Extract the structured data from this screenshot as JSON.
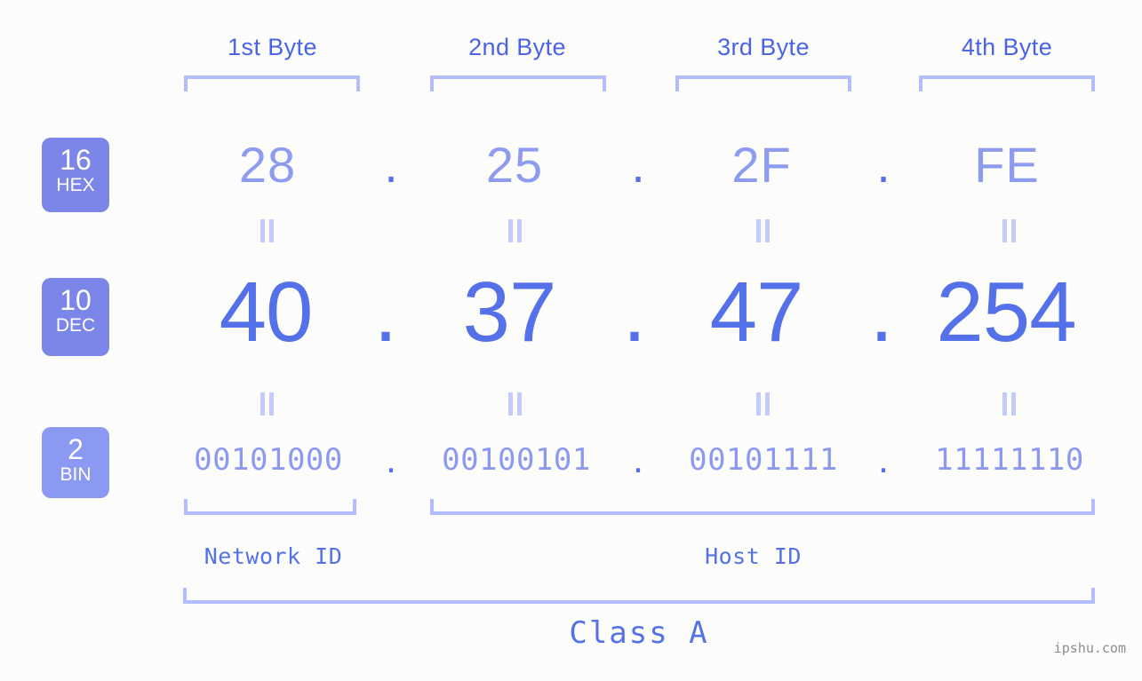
{
  "meta": {
    "watermark": "ipshu.com",
    "background_color": "#fcfdfa",
    "accent_color": "#5571ea",
    "accent_light_color": "#8b99f2",
    "bracket_color": "#b3bdfb",
    "badge_color": "#7b86e8"
  },
  "byte_headers": [
    {
      "label": "1st Byte"
    },
    {
      "label": "2nd Byte"
    },
    {
      "label": "3rd Byte"
    },
    {
      "label": "4th Byte"
    }
  ],
  "rows": [
    {
      "base_number": "16",
      "base_abbr": "HEX",
      "values": [
        "28",
        "25",
        "2F",
        "FE"
      ],
      "separator": "."
    },
    {
      "base_number": "10",
      "base_abbr": "DEC",
      "values": [
        "40",
        "37",
        "47",
        "254"
      ],
      "separator": "."
    },
    {
      "base_number": "2",
      "base_abbr": "BIN",
      "values": [
        "00101000",
        "00100101",
        "00101111",
        "11111110"
      ],
      "separator": "."
    }
  ],
  "equals_symbol": "=",
  "sections": {
    "network_id": "Network ID",
    "host_id": "Host ID",
    "class": "Class A"
  }
}
